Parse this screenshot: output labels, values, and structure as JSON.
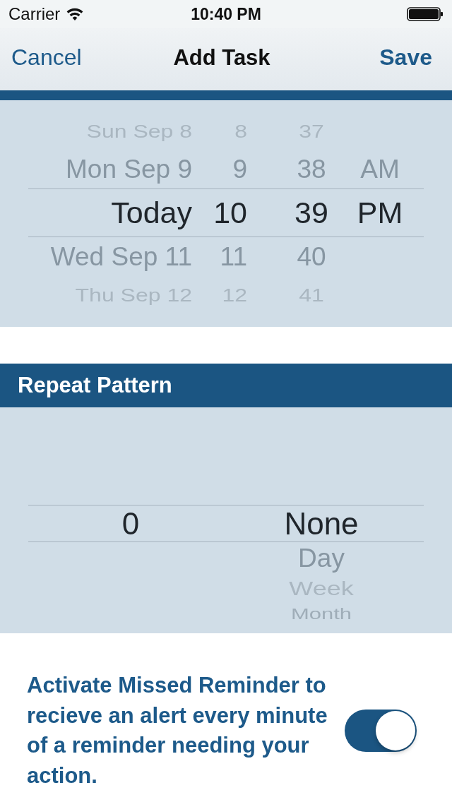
{
  "status_bar": {
    "carrier": "Carrier",
    "time": "10:40 PM"
  },
  "nav_bar": {
    "left_button": "Cancel",
    "title": "Add Task",
    "right_button": "Save"
  },
  "date_picker": {
    "columns": [
      {
        "items": [
          {
            "label": "Sun Sep 8",
            "selected": false
          },
          {
            "label": "Mon Sep 9",
            "selected": false
          },
          {
            "label": "Today",
            "selected": true
          },
          {
            "label": "Wed Sep 11",
            "selected": false
          },
          {
            "label": "Thu Sep 12",
            "selected": false
          }
        ]
      },
      {
        "items": [
          {
            "label": "8",
            "selected": false
          },
          {
            "label": "9",
            "selected": false
          },
          {
            "label": "10",
            "selected": true
          },
          {
            "label": "11",
            "selected": false
          },
          {
            "label": "12",
            "selected": false
          }
        ]
      },
      {
        "items": [
          {
            "label": "37",
            "selected": false
          },
          {
            "label": "38",
            "selected": false
          },
          {
            "label": "39",
            "selected": true
          },
          {
            "label": "40",
            "selected": false
          },
          {
            "label": "41",
            "selected": false
          }
        ]
      },
      {
        "items": [
          {
            "label": "AM",
            "selected": false
          },
          {
            "label": "PM",
            "selected": true
          }
        ]
      }
    ]
  },
  "repeat_section": {
    "title": "Repeat Pattern",
    "picker": {
      "columns": [
        {
          "items": [
            {
              "label": "0",
              "selected": true
            }
          ]
        },
        {
          "items": [
            {
              "label": "None",
              "selected": true
            },
            {
              "label": "Day",
              "selected": false
            },
            {
              "label": "Week",
              "selected": false
            },
            {
              "label": "Month",
              "selected": false
            }
          ]
        }
      ]
    }
  },
  "missed_reminder": {
    "text": "Activate Missed Reminder to recieve an alert every minute of a reminder needing your action.",
    "on": true
  }
}
